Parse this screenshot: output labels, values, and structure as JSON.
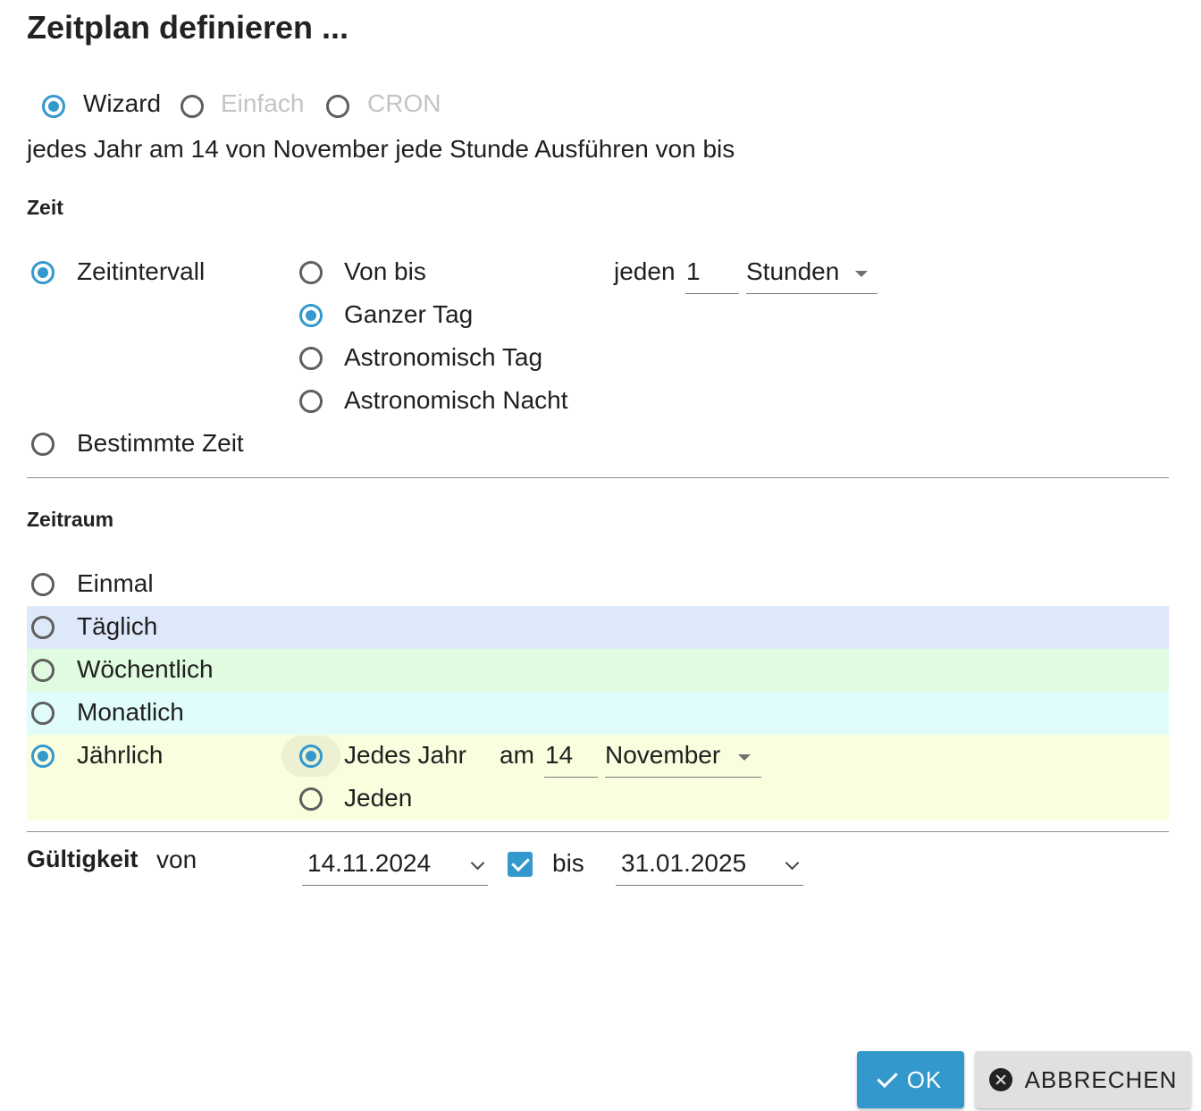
{
  "dialog": {
    "title": "Zeitplan definieren ..."
  },
  "mode": {
    "options": [
      "Wizard",
      "Einfach",
      "CRON"
    ],
    "selected": "Wizard"
  },
  "summary": "jedes Jahr am 14 von November jede Stunde Ausführen von bis",
  "zeit": {
    "heading": "Zeit",
    "zeitintervall_label": "Zeitintervall",
    "bestimmte_zeit_label": "Bestimmte Zeit",
    "range_options": [
      "Von bis",
      "Ganzer Tag",
      "Astronomisch Tag",
      "Astronomisch Nacht"
    ],
    "range_selected": "Ganzer Tag",
    "every_label": "jeden",
    "every_value": "1",
    "unit_value": "Stunden"
  },
  "zeitraum": {
    "heading": "Zeitraum",
    "options": [
      "Einmal",
      "Täglich",
      "Wöchentlich",
      "Monatlich",
      "Jährlich"
    ],
    "selected": "Jährlich",
    "yearly": {
      "jedes_jahr_label": "Jedes Jahr",
      "jeden_label": "Jeden",
      "am_label": "am",
      "day_value": "14",
      "month_value": "November"
    }
  },
  "validity": {
    "label": "Gültigkeit",
    "from_label": "von",
    "from_value": "14.11.2024",
    "until_checked": true,
    "until_label": "bis",
    "until_value": "31.01.2025"
  },
  "buttons": {
    "ok": "OK",
    "cancel": "ABBRECHEN"
  },
  "colors": {
    "accent": "#3399cc",
    "band_daily": "#dee8fb",
    "band_weekly": "#e0fbdf",
    "band_monthly": "#e0fdfc",
    "band_yearly": "#fbfddf"
  }
}
